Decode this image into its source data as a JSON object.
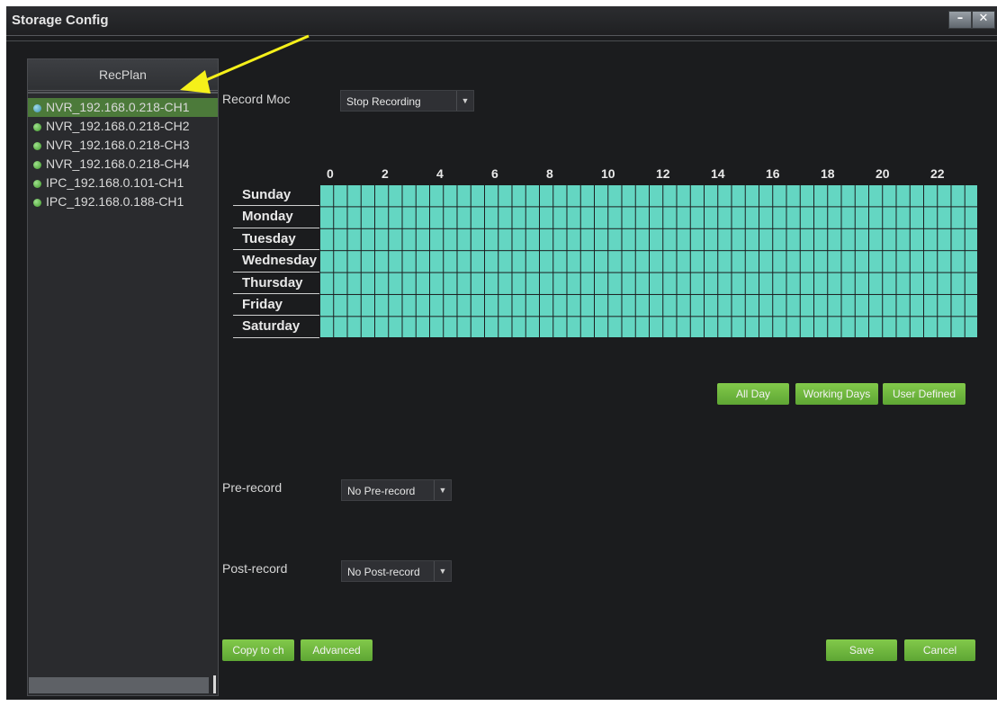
{
  "window": {
    "title": "Storage Config",
    "minimize_label": "–",
    "close_label": "✕"
  },
  "sidebar": {
    "header": "RecPlan",
    "channels": [
      {
        "label": "NVR_192.168.0.218-CH1",
        "selected": true
      },
      {
        "label": "NVR_192.168.0.218-CH2",
        "selected": false
      },
      {
        "label": "NVR_192.168.0.218-CH3",
        "selected": false
      },
      {
        "label": "NVR_192.168.0.218-CH4",
        "selected": false
      },
      {
        "label": "IPC_192.168.0.101-CH1",
        "selected": false
      },
      {
        "label": "IPC_192.168.0.188-CH1",
        "selected": false
      }
    ]
  },
  "record_mode": {
    "label": "Record Moc",
    "value": "Stop Recording"
  },
  "schedule": {
    "hour_labels": [
      "0",
      "2",
      "4",
      "6",
      "8",
      "10",
      "12",
      "14",
      "16",
      "18",
      "20",
      "22"
    ],
    "days": [
      "Sunday",
      "Monday",
      "Tuesday",
      "Wednesday",
      "Thursday",
      "Friday",
      "Saturday"
    ],
    "fill_color": "#64d6c2"
  },
  "presets": {
    "all_day": "All Day",
    "working_days": "Working Days",
    "user_defined": "User Defined"
  },
  "pre_record": {
    "label": "Pre-record",
    "value": "No Pre-record"
  },
  "post_record": {
    "label": "Post-record",
    "value": "No Post-record"
  },
  "footer": {
    "copy_label": "Copy to ch",
    "advanced_label": "Advanced",
    "save_label": "Save",
    "cancel_label": "Cancel"
  },
  "colors": {
    "accent_green": "#6cb83f",
    "annotation_arrow": "#f5f01a"
  }
}
